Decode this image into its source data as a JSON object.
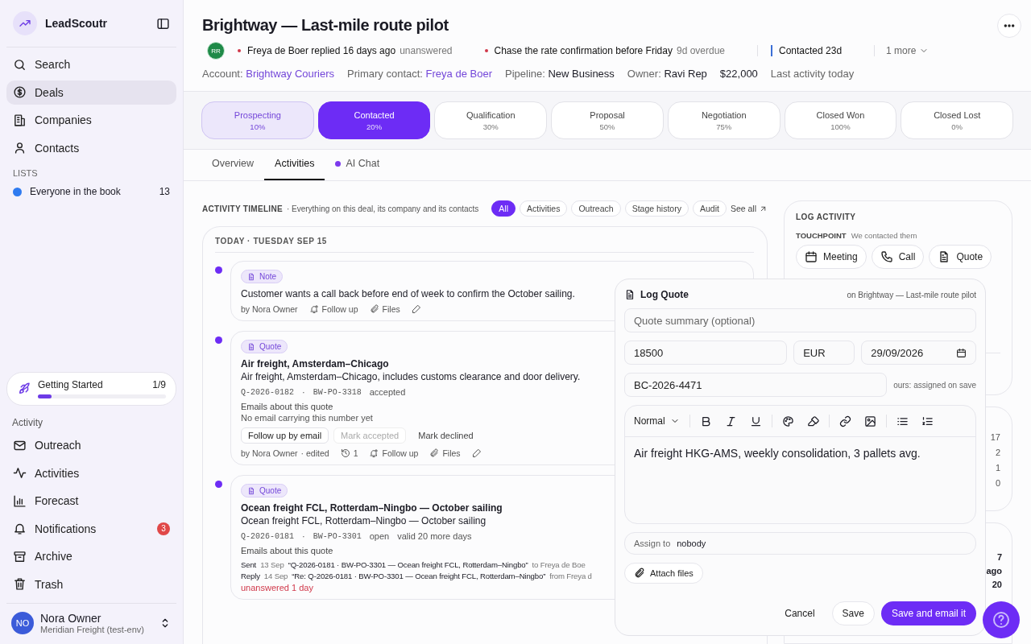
{
  "app": {
    "name": "LeadScoutr"
  },
  "nav": [
    {
      "label": "Search",
      "selected": false
    },
    {
      "label": "Deals",
      "selected": true
    },
    {
      "label": "Companies",
      "selected": false
    },
    {
      "label": "Contacts",
      "selected": false
    }
  ],
  "lists": {
    "heading": "LISTS",
    "items": [
      {
        "label": "Everyone in the book",
        "count": "13",
        "color": "#2f7bf0"
      }
    ]
  },
  "getting_started": {
    "label": "Getting Started",
    "progress": "1/9",
    "level": 0.11
  },
  "activity_section": {
    "heading": "Activity",
    "items": [
      {
        "label": "Outreach"
      },
      {
        "label": "Activities"
      },
      {
        "label": "Forecast"
      },
      {
        "label": "Notifications",
        "badge": "3"
      },
      {
        "label": "Archive"
      },
      {
        "label": "Trash"
      }
    ]
  },
  "user": {
    "initials": "NO",
    "name": "Nora Owner",
    "org": "Meridian Freight (test-env)"
  },
  "deal": {
    "title": "Brightway — Last-mile route pilot",
    "owner_initials": "RR",
    "signals": [
      {
        "kind": "alert",
        "text": "Freya de Boer replied 16 days ago",
        "note": "unanswered"
      },
      {
        "kind": "alert",
        "text": "Chase the rate confirmation before Friday",
        "note": "9d overdue"
      },
      {
        "kind": "stage",
        "text": "Contacted 23d"
      }
    ],
    "more": "1 more",
    "info": [
      {
        "label": "Account:",
        "value": "Brightway Couriers",
        "kind": "link"
      },
      {
        "label": "Primary contact:",
        "value": "Freya de Boer",
        "kind": "link"
      },
      {
        "label": "Pipeline:",
        "value": "New Business",
        "kind": "plain"
      },
      {
        "label": "Owner:",
        "value": "Ravi Rep",
        "kind": "plain"
      },
      {
        "value": "$22,000",
        "kind": "amount"
      },
      {
        "value": "Last activity today",
        "kind": "muted"
      }
    ]
  },
  "stages": [
    {
      "name": "Prospecting",
      "percent": "10%",
      "passed": true,
      "selected": false
    },
    {
      "name": "Contacted",
      "percent": "20%",
      "passed": false,
      "selected": true
    },
    {
      "name": "Qualification",
      "percent": "30%",
      "passed": false,
      "selected": false
    },
    {
      "name": "Proposal",
      "percent": "50%",
      "passed": false,
      "selected": false
    },
    {
      "name": "Negotiation",
      "percent": "75%",
      "passed": false,
      "selected": false
    },
    {
      "name": "Closed Won",
      "percent": "100%",
      "passed": false,
      "selected": false
    },
    {
      "name": "Closed Lost",
      "percent": "0%",
      "passed": false,
      "selected": false
    }
  ],
  "tabs": [
    {
      "label": "Overview",
      "selected": false,
      "indicator": false
    },
    {
      "label": "Activities",
      "selected": true,
      "indicator": false
    },
    {
      "label": "AI Chat",
      "selected": false,
      "indicator": true
    }
  ],
  "timeline": {
    "heading": "ACTIVITY TIMELINE",
    "subtitle": "· Everything on this deal, its company and its contacts",
    "filters": [
      {
        "label": "All",
        "selected": true
      },
      {
        "label": "Activities",
        "selected": false
      },
      {
        "label": "Outreach",
        "selected": false
      },
      {
        "label": "Stage history",
        "selected": false
      },
      {
        "label": "Audit",
        "selected": false
      }
    ],
    "see_all": "See all",
    "day": "TODAY · TUESDAY SEP 15",
    "items": [
      {
        "kind": "note",
        "tag": "Note",
        "body": "Customer wants a call back before end of week to confirm the October sailing.",
        "footer": [
          {
            "kind": "author",
            "text": "by Nora Owner"
          },
          {
            "kind": "followup",
            "text": "Follow up"
          },
          {
            "kind": "files",
            "text": "Files"
          },
          {
            "kind": "edit"
          }
        ]
      },
      {
        "kind": "quote",
        "tag": "Quote",
        "title": "Air freight, Amsterdam–Chicago",
        "body": "Air freight, Amsterdam–Chicago, includes customs clearance and door delivery.",
        "refs": [
          "Q-2026-0182",
          "·",
          "BW-PO-3318"
        ],
        "status": "accepted",
        "emails_heading": "Emails about this quote",
        "emails_empty": "No email carrying this number yet",
        "actions": [
          {
            "label": "Follow up by email",
            "disabled": false,
            "kind": "outlined"
          },
          {
            "label": "Mark accepted",
            "disabled": true,
            "kind": "outlined"
          },
          {
            "label": "Mark declined",
            "disabled": false,
            "kind": "plain"
          }
        ],
        "footer": [
          {
            "kind": "author",
            "text": "by Nora Owner"
          },
          {
            "kind": "edited",
            "text": "· edited"
          },
          {
            "kind": "history",
            "text": "1"
          },
          {
            "kind": "followup",
            "text": "Follow up"
          },
          {
            "kind": "files",
            "text": "Files"
          },
          {
            "kind": "edit"
          }
        ]
      },
      {
        "kind": "quote",
        "tag": "Quote",
        "title": "Ocean freight FCL, Rotterdam–Ningbo — October sailing",
        "body": "Ocean freight FCL, Rotterdam–Ningbo — October sailing",
        "refs": [
          "Q-2026-0181",
          "·",
          "BW-PO-3301"
        ],
        "status": "open",
        "validity": "valid 20 more days",
        "emails_heading": "Emails about this quote",
        "emails": [
          {
            "label": "Sent",
            "date": "13 Sep",
            "subject": "“Q-2026-0181 · BW-PO-3301 — Ocean freight FCL, Rotterdam–Ningbo”",
            "party": "to Freya de Boe"
          },
          {
            "label": "Reply",
            "date": "14 Sep",
            "subject": "“Re: Q-2026-0181 · BW-PO-3301 — Ocean freight FCL, Rotterdam–Ningbo”",
            "party": "from Freya d"
          }
        ],
        "alert": "unanswered 1 day"
      }
    ]
  },
  "log_activity": {
    "heading": "LOG ACTIVITY",
    "touchpoint": "TOUCHPOINT",
    "touchpoint_hint": "We contacted them",
    "buttons": [
      {
        "label": "Meeting"
      },
      {
        "label": "Call"
      },
      {
        "label": "Quote"
      }
    ]
  },
  "side_counts": [
    "17",
    "2",
    "1",
    "0"
  ],
  "side_card_3": [
    "7",
    "ago",
    "20"
  ],
  "log_quote": {
    "title": "Log Quote",
    "context": "on Brightway — Last-mile route pilot",
    "summary_placeholder": "Quote summary (optional)",
    "amount": "18500",
    "currency": "EUR",
    "valid_until": "29/09/2026",
    "reference": "BC-2026-4471",
    "reference_note": "ours: assigned on save",
    "format": "Normal",
    "body": "Air freight HKG-AMS, weekly consolidation, 3 pallets avg.",
    "assign_label": "Assign to",
    "assign_value": "nobody",
    "attach": "Attach files",
    "buttons": [
      {
        "label": "Cancel",
        "kind": "text"
      },
      {
        "label": "Save",
        "kind": "outlined"
      },
      {
        "label": "Save and email it",
        "kind": "primary"
      }
    ]
  }
}
